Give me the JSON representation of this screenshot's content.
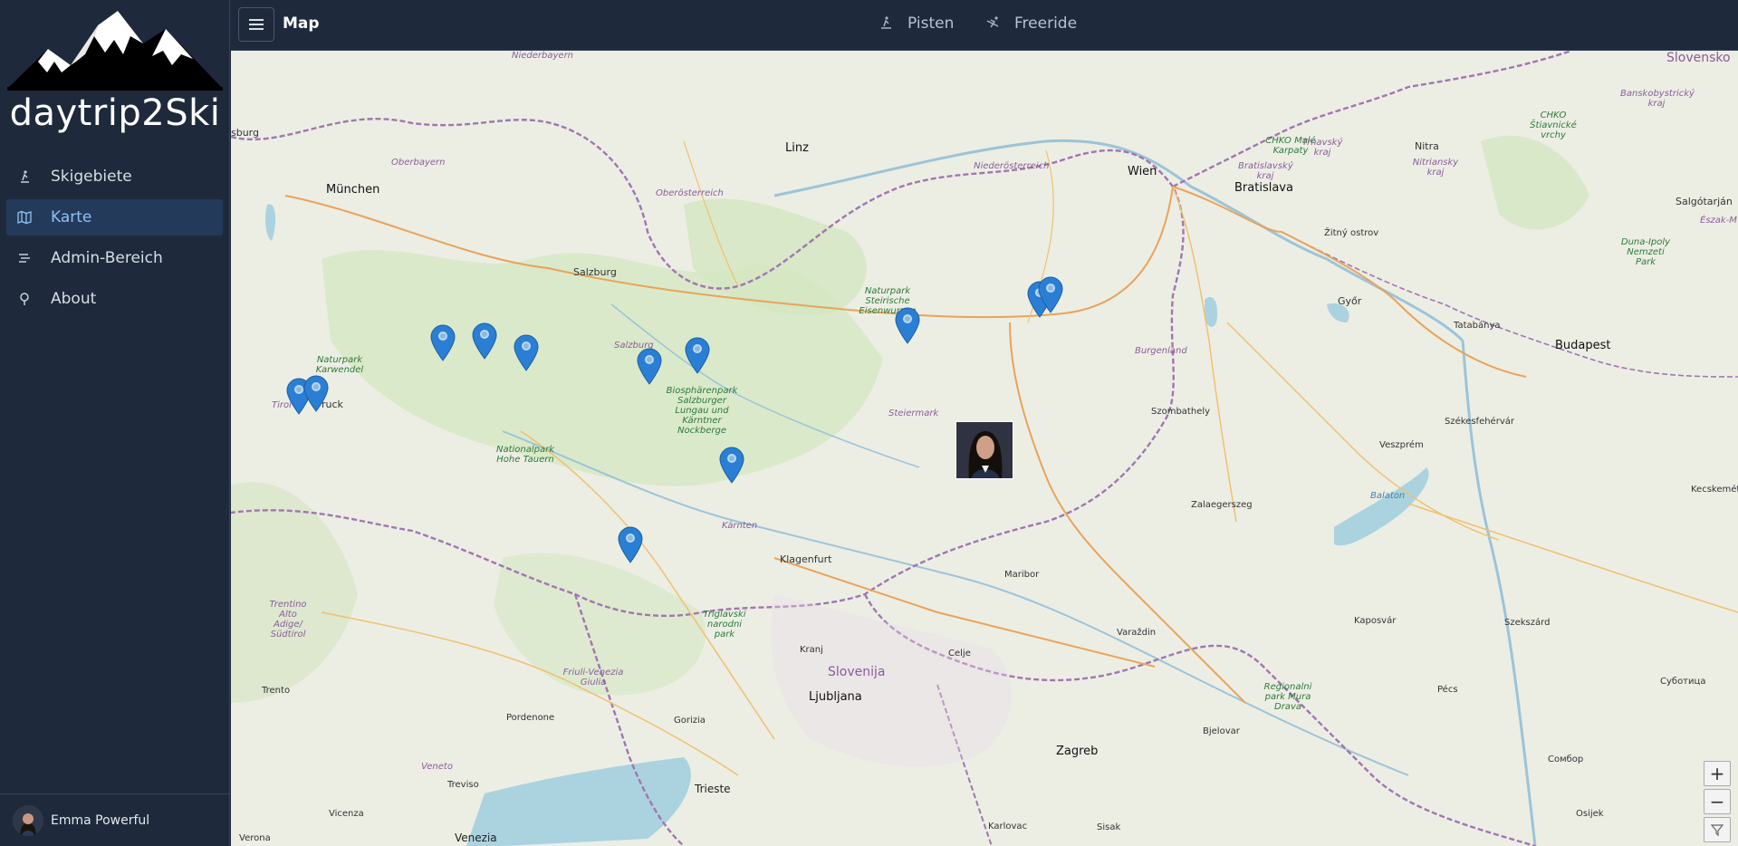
{
  "app": {
    "brand": "daytrip2Ski"
  },
  "sidebar": {
    "items": [
      {
        "label": "Skigebiete",
        "icon": "skier-icon"
      },
      {
        "label": "Karte",
        "icon": "map-icon",
        "active": true
      },
      {
        "label": "Admin-Bereich",
        "icon": "list-icon"
      },
      {
        "label": "About",
        "icon": "pin-question-icon"
      }
    ],
    "user": {
      "name": "Emma Powerful"
    }
  },
  "topbar": {
    "title": "Map",
    "links": [
      {
        "label": "Pisten",
        "icon": "skier-icon"
      },
      {
        "label": "Freeride",
        "icon": "freeride-icon"
      }
    ]
  },
  "map": {
    "labels": {
      "niederbayern": "Niederbayern",
      "regensburg": "sburg",
      "oberbayern": "Oberbayern",
      "muenchen": "München",
      "linz": "Linz",
      "oberoesterreich": "Oberösterreich",
      "niederoesterreich": "Niederösterreich",
      "wien": "Wien",
      "bratislava": "Bratislava",
      "bratislavsky": "Bratislavský kraj",
      "chko_male": "CHKO Malé Karpaty",
      "trnavsky": "Trnavský kraj",
      "nitra": "Nitra",
      "nitriansky": "Nitriansky kraj",
      "chko_stiavnicke": "CHKO Štiavnické vrchy",
      "banskobystricky": "Banskobystrický kraj",
      "slovensko": "Slovensko",
      "salgotarjan": "Salgótarján",
      "eszak": "Észak-M",
      "zitny": "Žitný ostrov",
      "salzburg_city": "Salzburg",
      "salzburg_land": "Salzburg",
      "naturpark_karwendel": "Naturpark Karwendel",
      "tirol": "Tirol",
      "innsbruck": "ruck",
      "naturpark_eisenwurzen": "Naturpark Steirische Eisenwurzen",
      "burgenland": "Burgenland",
      "gyor": "Győr",
      "tatabanya": "Tatabánya",
      "budapest": "Budapest",
      "duna_ipoly": "Duna-Ipoly Nemzeti Park",
      "biosphaerenpark": "Biosphärenpark Salzburger Lungau und Kärntner Nockberge",
      "nationalpark_hohe_tauern": "Nationalpark Hohe Tauern",
      "steiermark": "Steiermark",
      "szombathely": "Szombathely",
      "szekesfehervar": "Székesfehérvár",
      "veszprem": "Veszprém",
      "kecskemet": "Kecskemét",
      "balaton": "Balaton",
      "zalaegerszeg": "Zalaegerszeg",
      "kaernten": "Kärnten",
      "klagenfurt": "Klagenfurt",
      "maribor": "Maribor",
      "trentino": "Trentino Alto Adige/ Südtirol",
      "triglavski": "Triglavski narodni park",
      "kranj": "Kranj",
      "celje": "Celje",
      "varazdin": "Varaždin",
      "kaposvar": "Kaposvár",
      "szekszard": "Szekszárd",
      "slovenija": "Slovenija",
      "ljubljana": "Ljubljana",
      "friuli": "Friuli-Venezia Giulia",
      "trento": "Trento",
      "pordenone": "Pordenone",
      "gorizia": "Gorizia",
      "regionalni_park": "Regionalni park Mura Drava",
      "pecs": "Pécs",
      "subotica": "Суботица",
      "bjelovar": "Bjelovar",
      "zagreb": "Zagreb",
      "sombor": "Сомбор",
      "veneto": "Veneto",
      "treviso": "Treviso",
      "trieste": "Trieste",
      "vicenza": "Vicenza",
      "karlovac": "Karlovac",
      "sisak": "Sisak",
      "osijek": "Osijek",
      "verona": "Verona",
      "venezia": "Venezia"
    },
    "zoom_in": "+",
    "zoom_out": "−",
    "pin_color": "#2a7fd4"
  }
}
